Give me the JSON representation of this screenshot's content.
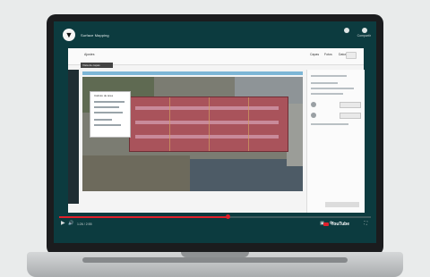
{
  "video": {
    "title": "Surface Mapping",
    "channel_initial": "▼",
    "share_label": "Compartir"
  },
  "app": {
    "tabs": [
      "Ajustes",
      "Capas",
      "Fotos",
      "Datos"
    ],
    "tooltip": "Vista de capas",
    "info_panel_title": "Cálculo de área"
  },
  "player": {
    "time": "1:26 / 2:55",
    "progress": 0.54,
    "logo": "YouTube",
    "icons": [
      "play-icon",
      "volume-icon",
      "captions-icon",
      "settings-icon"
    ]
  },
  "colors": {
    "screen_bg": "#0c3b3f",
    "roof": "#a9535b",
    "progress": "#e0202b"
  }
}
